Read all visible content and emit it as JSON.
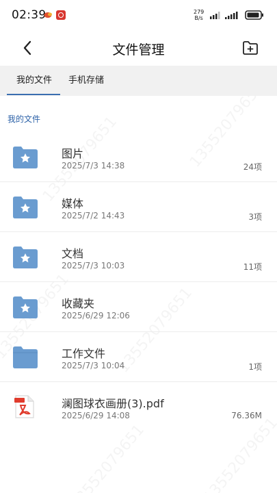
{
  "status_bar": {
    "time": "02:39",
    "net_speed_value": "279",
    "net_speed_unit": "B/s",
    "icons": [
      "notification-app-icon",
      "notification-badge-icon",
      "signal-icon",
      "signal-icon",
      "battery-icon"
    ]
  },
  "header": {
    "title": "文件管理",
    "back_icon": "back-arrow-icon",
    "new_folder_icon": "new-folder-icon"
  },
  "tabs": [
    {
      "label": "我的文件",
      "active": true
    },
    {
      "label": "手机存储",
      "active": false
    }
  ],
  "breadcrumb": "我的文件",
  "files": [
    {
      "name": "图片",
      "date": "2025/7/3 14:38",
      "meta": "24项",
      "icon": "starred-folder-icon"
    },
    {
      "name": "媒体",
      "date": "2025/7/2 14:43",
      "meta": "3项",
      "icon": "starred-folder-icon"
    },
    {
      "name": "文档",
      "date": "2025/7/3 10:03",
      "meta": "11项",
      "icon": "starred-folder-icon"
    },
    {
      "name": "收藏夹",
      "date": "2025/6/29 12:06",
      "meta": "",
      "icon": "starred-folder-icon"
    },
    {
      "name": "工作文件",
      "date": "2025/7/3 10:04",
      "meta": "1项",
      "icon": "folder-icon"
    },
    {
      "name": "澜图球衣画册(3).pdf",
      "date": "2025/6/29 14:08",
      "meta": "76.36M",
      "icon": "pdf-file-icon"
    }
  ],
  "watermark_text": "13552079651",
  "colors": {
    "accent": "#3a6eb0",
    "folder": "#6a9cd0",
    "tab_bar_bg": "#f1f1f1",
    "pdf_red": "#e03b2d"
  }
}
